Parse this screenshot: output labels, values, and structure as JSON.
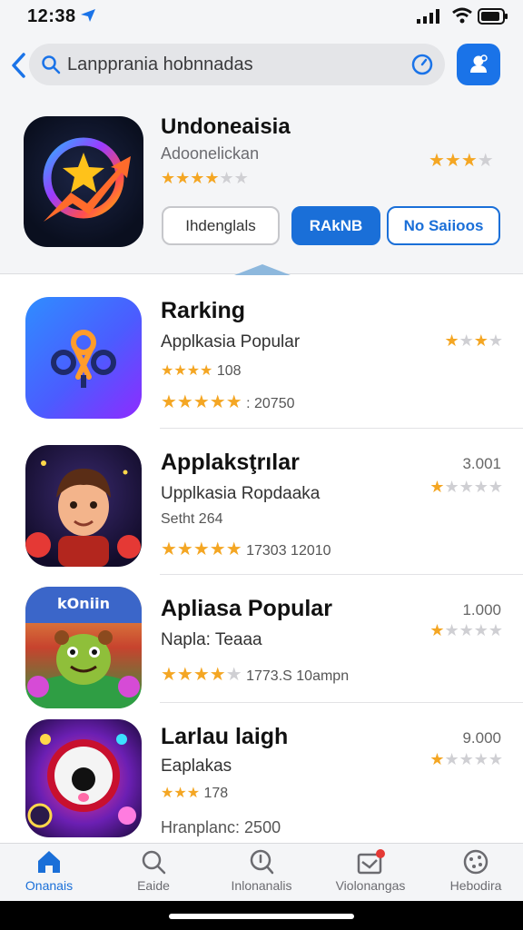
{
  "status": {
    "time": "12:38"
  },
  "search": {
    "placeholder": "Lanpprania hobnnadas"
  },
  "featured": {
    "title": "Undoneaisia",
    "subtitle": "Adoonelickan",
    "rating": 3.5,
    "right_rating": 3.5,
    "buttons": [
      "Ihdenglals",
      "RAkNB",
      "No Saiioos"
    ]
  },
  "list": [
    {
      "title": "Rarking",
      "subtitle": "Applkasia Popular",
      "meta_count": "108",
      "stats": ": 20750",
      "right_count": "",
      "rating": 3.5
    },
    {
      "title": "Applaksţrılar",
      "subtitle": "Upplkasia Ropdaaka",
      "meta_text": "Setht 264",
      "stats": "17303   12010",
      "right_count": "3.001",
      "rating": 1
    },
    {
      "title": "Apliasa Popular",
      "subtitle": "Napla: Teaaa",
      "stats": "1773.S   10ampn",
      "right_count": "1.000",
      "rating": 1
    },
    {
      "title": "Larlau laigh",
      "subtitle": "Eaplakas",
      "meta_count": "178",
      "stats": "Hranplanc: 2500",
      "right_count": "9.000",
      "rating": 1.5
    }
  ],
  "tabs": [
    {
      "label": "Onanais",
      "icon": "home-icon",
      "active": true
    },
    {
      "label": "Eaide",
      "icon": "search-icon",
      "active": false
    },
    {
      "label": "Inlonanalis",
      "icon": "info-search-icon",
      "active": false
    },
    {
      "label": "Violonangas",
      "icon": "inbox-icon",
      "active": false
    },
    {
      "label": "Hebodira",
      "icon": "settings-icon",
      "active": false
    }
  ],
  "colors": {
    "accent": "#1a6fd8",
    "star": "#f4a623",
    "star_empty": "#cfcfd3",
    "background": "#f4f5f7",
    "badge": "#e53935"
  }
}
